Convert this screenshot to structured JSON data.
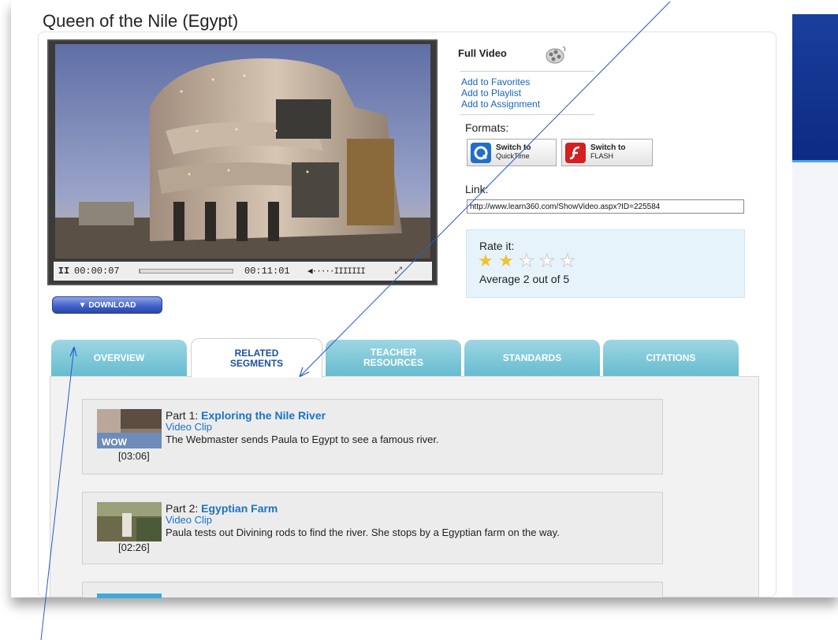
{
  "page": {
    "title": "Queen of the Nile (Egypt)"
  },
  "player": {
    "pause_glyph": "II",
    "current_time": "00:00:07",
    "duration": "00:11:01",
    "progress_fraction": 0.01,
    "volume_glyph": "◀·····IIIIIII",
    "fullscreen_glyph": "⤢"
  },
  "download": {
    "label": "▼ DOWNLOAD"
  },
  "info": {
    "full_video_label": "Full Video",
    "actions": [
      "Add to Favorites",
      "Add to Playlist",
      "Add to Assignment"
    ],
    "formats_label": "Formats:",
    "format_buttons": [
      {
        "title": "Switch to",
        "sub": "QuickTime",
        "icon": "quicktime-icon"
      },
      {
        "title": "Switch to",
        "sub": "FLASH",
        "icon": "flash-icon"
      }
    ],
    "link_label": "Link:",
    "link_value": "http://www.learn360.com/ShowVideo.aspx?ID=225584"
  },
  "rating": {
    "title": "Rate it:",
    "value": 2,
    "max": 5,
    "average_text": "Average 2 out of 5"
  },
  "tabs": [
    {
      "line1": "OVERVIEW",
      "line2": "",
      "active": false
    },
    {
      "line1": "RELATED",
      "line2": "SEGMENTS",
      "active": true
    },
    {
      "line1": "TEACHER",
      "line2": "RESOURCES",
      "active": false
    },
    {
      "line1": "STANDARDS",
      "line2": "",
      "active": false
    },
    {
      "line1": "CITATIONS",
      "line2": "",
      "active": false
    }
  ],
  "segments": [
    {
      "part": "Part 1:",
      "title": "Exploring the Nile River",
      "type": "Video Clip",
      "description": "The Webmaster sends Paula to Egypt to see a famous river.",
      "duration": "[03:06]",
      "thumb_text": "WOW"
    },
    {
      "part": "Part 2:",
      "title": "Egyptian Farm",
      "type": "Video Clip",
      "description": "Paula tests out Divining rods to find the river. She stops by a Egyptian farm on the way.",
      "duration": "[02:26]"
    }
  ],
  "colors": {
    "link_blue": "#1565c0",
    "tab_teal": "#66bcd0",
    "banner_navy": "#0d2a83",
    "rating_bg": "#e6f3fb",
    "star_gold": "#f1c232"
  }
}
